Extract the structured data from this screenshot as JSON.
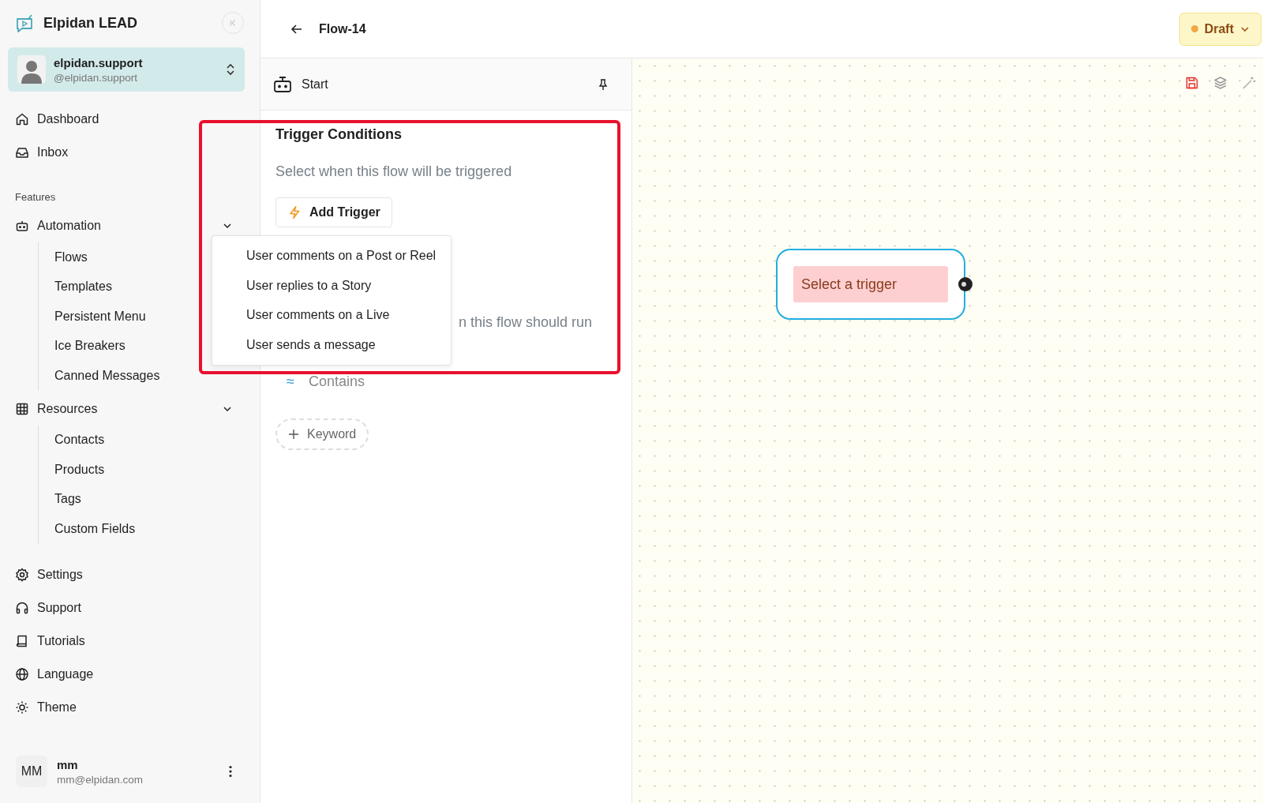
{
  "app": {
    "name": "Elpidan LEAD"
  },
  "account": {
    "name": "elpidan.support",
    "handle": "@elpidan.support"
  },
  "nav": [
    {
      "label": "Dashboard"
    },
    {
      "label": "Inbox"
    }
  ],
  "features_heading": "Features",
  "groups": [
    {
      "label": "Automation",
      "expanded": true,
      "children": [
        {
          "label": "Flows"
        },
        {
          "label": "Templates"
        },
        {
          "label": "Persistent Menu"
        },
        {
          "label": "Ice Breakers"
        },
        {
          "label": "Canned Messages"
        }
      ]
    },
    {
      "label": "Resources",
      "expanded": true,
      "children": [
        {
          "label": "Contacts"
        },
        {
          "label": "Products"
        },
        {
          "label": "Tags"
        },
        {
          "label": "Custom Fields"
        }
      ]
    }
  ],
  "bottom_nav": [
    {
      "label": "Settings"
    },
    {
      "label": "Support"
    },
    {
      "label": "Tutorials"
    },
    {
      "label": "Language"
    },
    {
      "label": "Theme"
    }
  ],
  "user": {
    "initials": "MM",
    "name": "mm",
    "email": "mm@elpidan.com"
  },
  "header": {
    "title": "Flow-14",
    "status": "Draft"
  },
  "panel": {
    "step": "Start",
    "heading": "Trigger Conditions",
    "subtitle": "Select when this flow will be triggered",
    "add_button": "Add Trigger",
    "partial_label": "n this flow should run",
    "match_options": [
      {
        "symbol": "≈",
        "label": "Contains"
      }
    ],
    "keyword_button": "Keyword"
  },
  "dropdown": {
    "items": [
      "User comments on a Post or Reel",
      "User replies to a Story",
      "User comments on a Live",
      "User sends a message"
    ]
  },
  "canvas": {
    "node": "Select a trigger"
  }
}
